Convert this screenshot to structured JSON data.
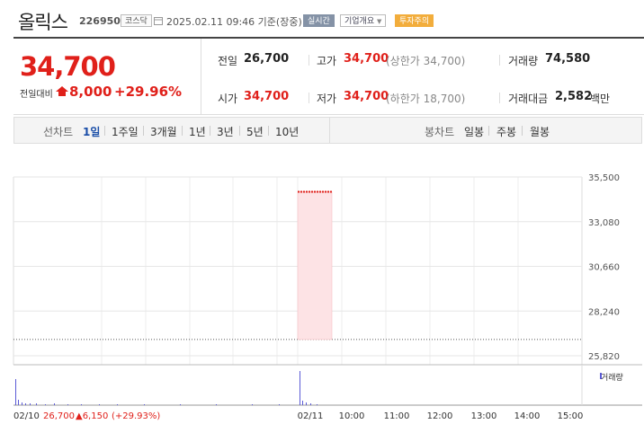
{
  "header": {
    "stock_name": "올릭스",
    "stock_code": "226950",
    "market": "코스닥",
    "datetime": "2025.02.11 09:46  기준(장중)",
    "realtime": "실시간",
    "company_info": "기업개요",
    "company_info_icon": "chevron-down-icon",
    "warning": "투자주의"
  },
  "summary": {
    "price": "34,700",
    "change_label": "전일대비",
    "change_amount": "8,000",
    "change_rate": "+29.96%",
    "prev_close_label": "전일",
    "prev_close": "26,700",
    "open_label": "시가",
    "open": "34,700",
    "high_label": "고가",
    "high": "34,700",
    "high_note": "(상한가 34,700)",
    "low_label": "저가",
    "low": "34,700",
    "low_note": "(하한가 18,700)",
    "volume_label": "거래량",
    "volume": "74,580",
    "amount_label": "거래대금",
    "amount": "2,582",
    "amount_unit": "백만"
  },
  "tabs": {
    "line_chart_label": "선차트",
    "periods": [
      "1일",
      "1주일",
      "3개월",
      "1년",
      "3년",
      "5년",
      "10년"
    ],
    "active_period": "1일",
    "candle_label": "봉차트",
    "candles": [
      "일봉",
      "주봉",
      "월봉"
    ]
  },
  "colors": {
    "up": "#e0201a",
    "active_tab": "#1a4ea8",
    "volume": "#5b5bd6",
    "band": "#fde3e5"
  },
  "chart_data": {
    "type": "line",
    "y_ticks": [
      "35,500",
      "33,080",
      "30,660",
      "28,240",
      "25,820"
    ],
    "ylim": [
      25820,
      35500
    ],
    "prev_close": 26700,
    "price_level": 34700,
    "x_labels": [
      "02/10",
      "02/11",
      "10:00",
      "11:00",
      "12:00",
      "13:00",
      "14:00",
      "15:00"
    ],
    "footer_prev": {
      "date": "02/10",
      "close": "26,700",
      "change": "▲6,150",
      "rate": "(+29.93%)"
    },
    "volume_legend": "거래량",
    "grid": true
  }
}
